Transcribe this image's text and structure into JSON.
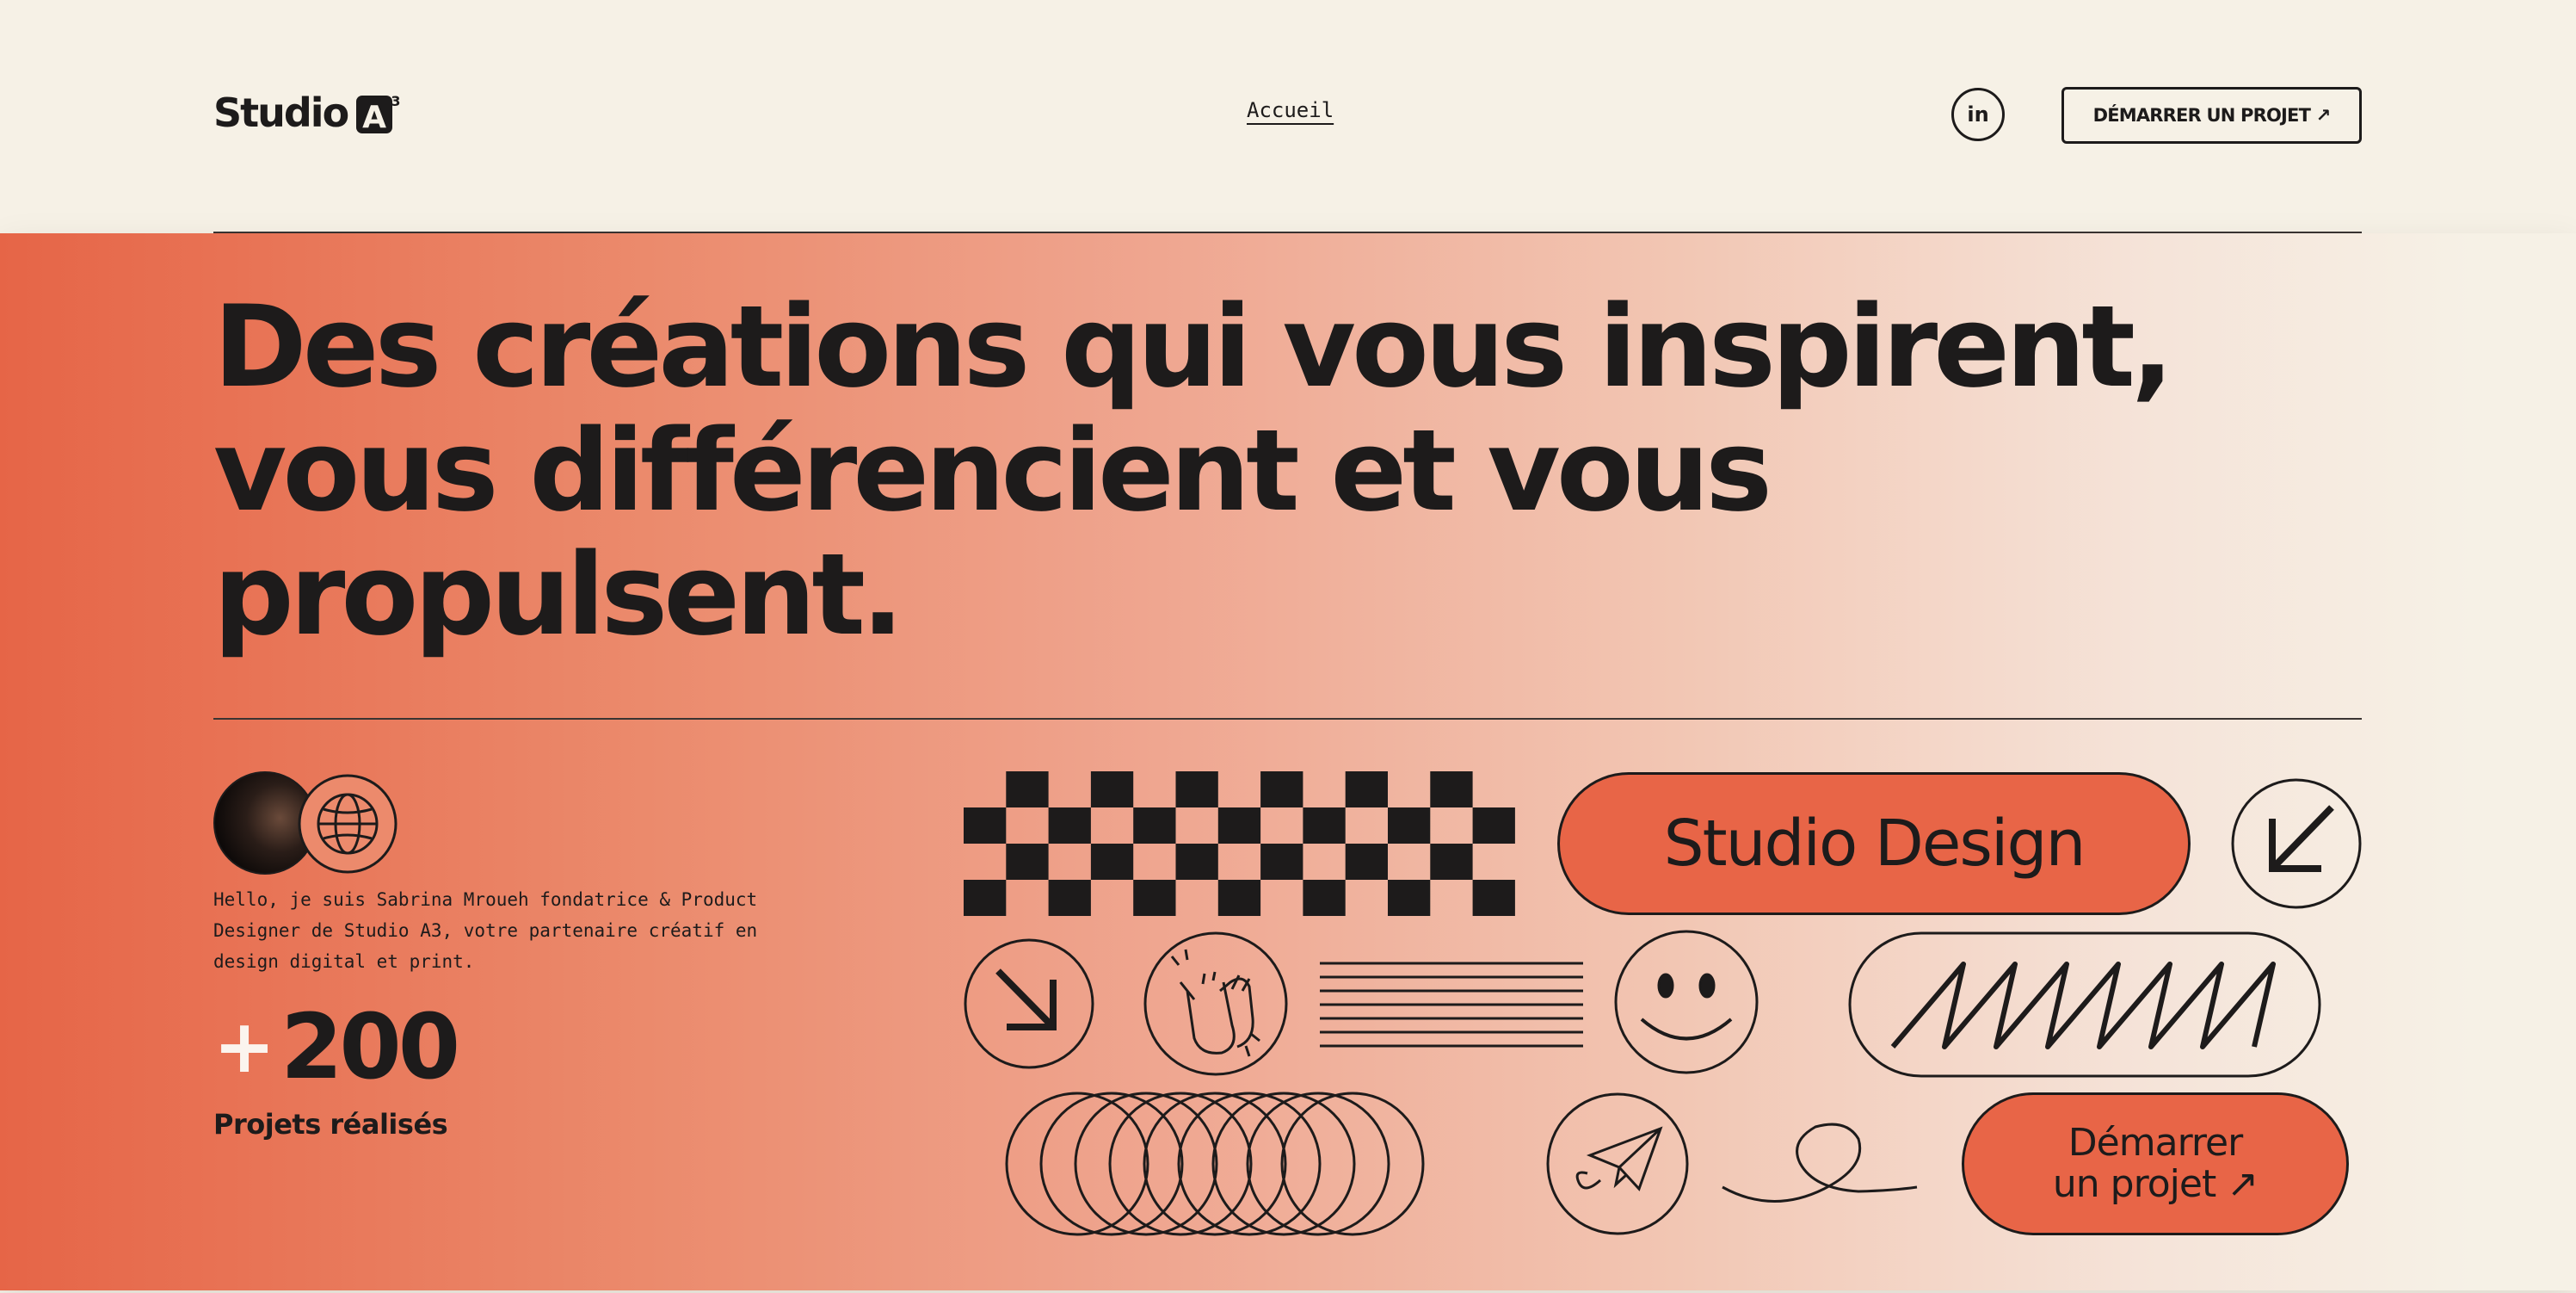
{
  "header": {
    "logo_text": "Studio",
    "logo_mark": "A",
    "logo_superscript": "3",
    "nav_link": "Accueil",
    "social_label": "in",
    "social_icon": "linkedin-icon",
    "cta_label": "DÉMARRER UN PROJET ↗"
  },
  "hero": {
    "headline": "Des créations qui vous inspirent, vous différencient et vous propulsent.",
    "intro": "Hello, je suis Sabrina Mroueh fondatrice & Product Designer de Studio A3, votre partenaire créatif en design digital et print.",
    "stat_prefix": "+",
    "stat_value": "200",
    "stat_label": "Projets réalisés",
    "avatar_icons": [
      "founder-photo",
      "globe-icon"
    ]
  },
  "graphics": {
    "studio_pill_label": "Studio Design",
    "start_pill_line1": "Démarrer",
    "start_pill_line2": "un projet ↗",
    "icons": [
      "checkerboard-pattern",
      "arrow-down-left-icon",
      "arrow-down-right-icon",
      "clapping-hands-icon",
      "horizontal-lines-pattern",
      "smiley-icon",
      "zigzag-pattern",
      "overlapping-circles-pattern",
      "paper-plane-icon",
      "loop-squiggle"
    ]
  },
  "colors": {
    "background": "#f6f1e6",
    "accent": "#e86547",
    "ink": "#1d1b1b"
  }
}
